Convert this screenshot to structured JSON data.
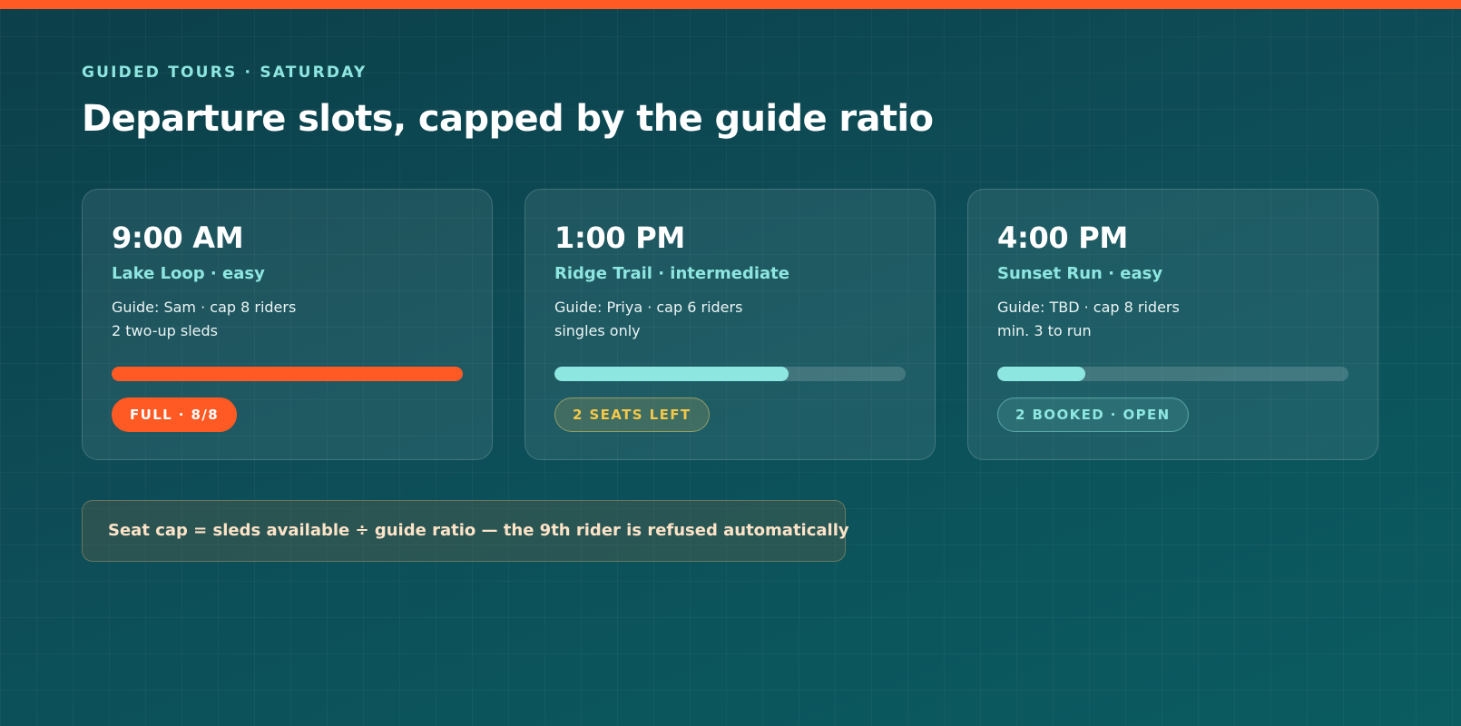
{
  "header": {
    "eyebrow": "GUIDED TOURS · SATURDAY",
    "title": "Departure slots, capped by the guide ratio"
  },
  "colors": {
    "accent_orange": "#ff5a24",
    "accent_teal": "#8ee6e0",
    "warn_yellow": "#f3c84a",
    "note_text": "#fde3c8"
  },
  "slots": [
    {
      "time": "9:00 AM",
      "route": "Lake Loop · easy",
      "guide_line": "Guide: Sam · cap 8 riders",
      "note_line": "2 two-up sleds",
      "fill_fraction": 1.0,
      "fill_color": "#ff5a24",
      "badge": "FULL · 8/8",
      "badge_kind": "full"
    },
    {
      "time": "1:00 PM",
      "route": "Ridge Trail · intermediate",
      "guide_line": "Guide: Priya · cap 6 riders",
      "note_line": "singles only",
      "fill_fraction": 0.667,
      "fill_color": "#8ee6e0",
      "badge": "2 SEATS LEFT",
      "badge_kind": "warn"
    },
    {
      "time": "4:00 PM",
      "route": "Sunset Run · easy",
      "guide_line": "Guide: TBD · cap 8 riders",
      "note_line": "min. 3 to run",
      "fill_fraction": 0.25,
      "fill_color": "#8ee6e0",
      "badge": "2 BOOKED · OPEN",
      "badge_kind": "open"
    }
  ],
  "footer_note": "Seat cap = sleds available ÷ guide ratio — the 9th rider is refused automatically"
}
